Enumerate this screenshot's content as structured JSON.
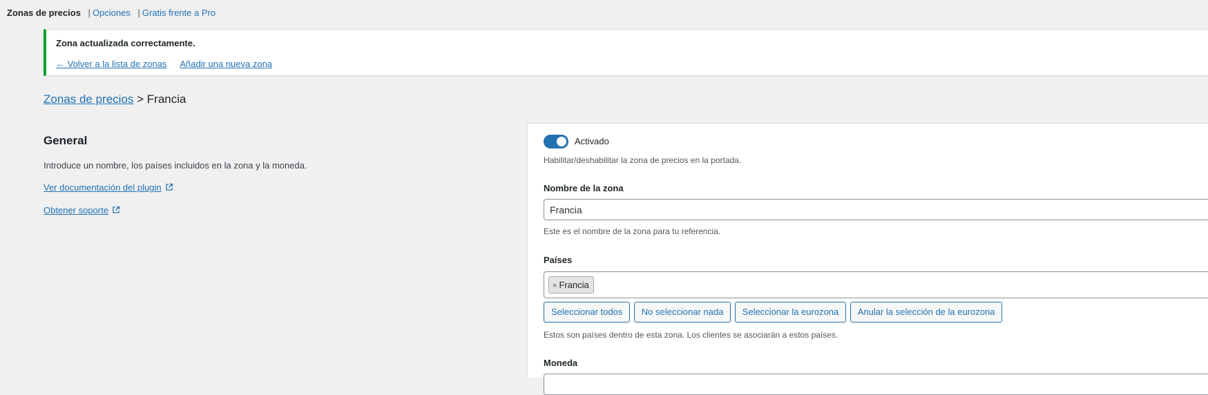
{
  "subnav": {
    "current": "Zonas de precios",
    "options_link": "Opciones",
    "pro_link": "Gratis frente a Pro"
  },
  "notice": {
    "message": "Zona actualizada correctamente.",
    "back_link": "← Volver a la lista de zonas",
    "add_link": "Añadir una nueva zona",
    "color": "#00a32a"
  },
  "breadcrumb": {
    "parent": "Zonas de precios",
    "separator": " > ",
    "current": "Francia"
  },
  "general": {
    "title": "General",
    "description": "Introduce un nombre, los países incluidos en la zona y la moneda.",
    "doc_link": "Ver documentación del plugin",
    "support_link": "Obtener soporte",
    "link_icon": "external-link-icon"
  },
  "form": {
    "enabled": true,
    "enabled_label": "Activado",
    "enabled_help": "Habilitar/deshabilitar la zona de precios en la portada.",
    "name_label": "Nombre de la zona",
    "name_value": "Francia",
    "name_help": "Este es el nombre de la zona para tu referencia.",
    "countries_label": "Países",
    "countries_selected": [
      "Francia"
    ],
    "chip_remove": "×",
    "buttons": {
      "select_all": "Seleccionar todos",
      "select_none": "No seleccionar nada",
      "select_eurozone": "Seleccionar la eurozona",
      "deselect_eurozone": "Anular la selección de la eurozona"
    },
    "countries_help": "Estos son países dentro de esta zona. Los clientes se asociarán a estos países.",
    "currency_label": "Moneda",
    "accent_color": "#2271b1"
  }
}
